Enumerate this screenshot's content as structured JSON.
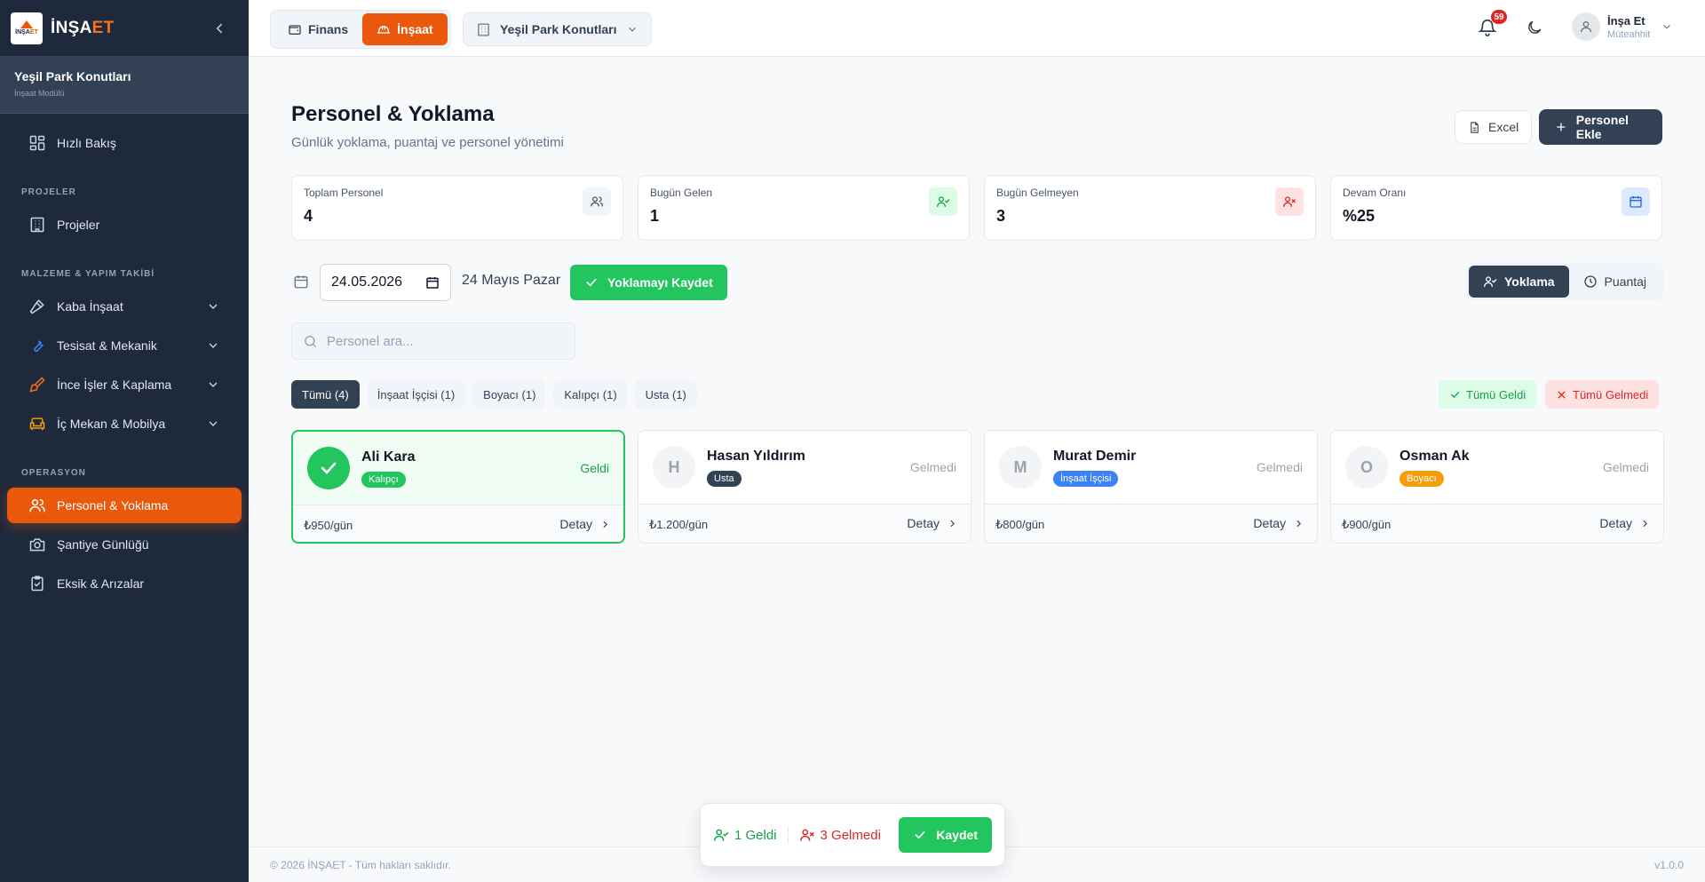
{
  "brand": {
    "logo_small_1": "İNŞA",
    "logo_small_2": "ET",
    "name_1": "İNŞA",
    "name_2": "ET"
  },
  "sidebar": {
    "project_name": "Yeşil Park Konutları",
    "project_module": "İnşaat Modülü",
    "quick": "Hızlı Bakış",
    "sections": {
      "projects": "PROJELER",
      "materials": "MALZEME & YAPIM TAKİBİ",
      "operations": "OPERASYON"
    },
    "items": {
      "projects": "Projeler",
      "rough": "Kaba İnşaat",
      "plumbing": "Tesisat & Mekanik",
      "finishing": "İnce İşler & Kaplama",
      "interior": "İç Mekan & Mobilya",
      "personnel": "Personel & Yoklama",
      "site_log": "Şantiye Günlüğü",
      "issues": "Eksik & Arızalar"
    }
  },
  "topbar": {
    "modules": [
      "Finans",
      "İnşaat"
    ],
    "project_select": "Yeşil Park Konutları",
    "notifications": "59",
    "user_name": "İnşa Et",
    "user_role": "Müteahhit"
  },
  "page": {
    "title": "Personel & Yoklama",
    "subtitle": "Günlük yoklama, puantaj ve personel yönetimi",
    "excel": "Excel",
    "add": "Personel Ekle"
  },
  "stats": [
    {
      "label": "Toplam Personel",
      "value": "4",
      "color": "#475569",
      "bg": "#f1f5f9"
    },
    {
      "label": "Bugün Gelen",
      "value": "1",
      "color": "#16a34a",
      "bg": "#dcfce7"
    },
    {
      "label": "Bugün Gelmeyen",
      "value": "3",
      "color": "#dc2626",
      "bg": "#fee2e2"
    },
    {
      "label": "Devam Oranı",
      "value": "%25",
      "color": "#2563eb",
      "bg": "#dbeafe"
    }
  ],
  "attendance": {
    "date_value": "24.05.2026",
    "date_label": "24 Mayıs Pazar",
    "save": "Yoklamayı Kaydet",
    "views": [
      "Yoklama",
      "Puantaj"
    ]
  },
  "search": {
    "placeholder": "Personel ara..."
  },
  "filters": [
    "Tümü (4)",
    "İnşaat İşçisi (1)",
    "Boyacı (1)",
    "Kalıpçı (1)",
    "Usta (1)"
  ],
  "bulk": {
    "all_present": "Tümü Geldi",
    "all_absent": "Tümü Gelmedi"
  },
  "personnel": [
    {
      "initial": "",
      "name": "Ali Kara",
      "role": "Kalıpçı",
      "role_color": "#22c55e",
      "status": "Geldi",
      "present": true,
      "wage": "₺950/gün",
      "detail": "Detay"
    },
    {
      "initial": "H",
      "name": "Hasan Yıldırım",
      "role": "Usta",
      "role_color": "#334155",
      "status": "Gelmedi",
      "present": false,
      "wage": "₺1.200/gün",
      "detail": "Detay"
    },
    {
      "initial": "M",
      "name": "Murat Demir",
      "role": "İnşaat İşçisi",
      "role_color": "#3b82f6",
      "status": "Gelmedi",
      "present": false,
      "wage": "₺800/gün",
      "detail": "Detay"
    },
    {
      "initial": "O",
      "name": "Osman Ak",
      "role": "Boyacı",
      "role_color": "#f59e0b",
      "status": "Gelmedi",
      "present": false,
      "wage": "₺900/gün",
      "detail": "Detay"
    }
  ],
  "floatbar": {
    "present": "1 Geldi",
    "absent": "3 Gelmedi",
    "save": "Kaydet"
  },
  "footer": {
    "copyright": "© 2026 İNŞAET - Tüm hakları saklıdır.",
    "version": "v1.0.0"
  }
}
